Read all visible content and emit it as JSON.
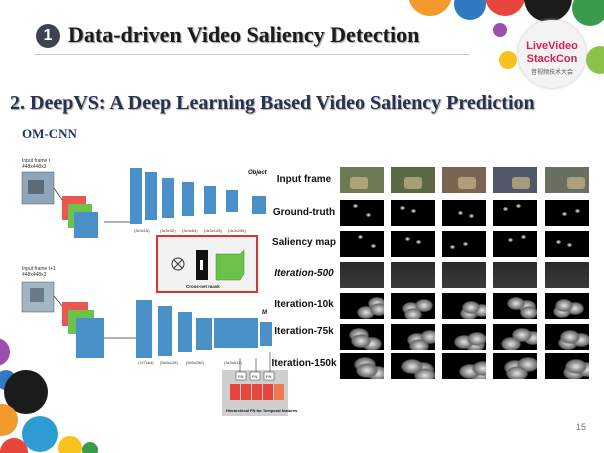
{
  "header": {
    "number": "1",
    "title": "Data-driven Video Saliency Detection"
  },
  "section": {
    "title": "2. DeepVS: A Deep Learning Based Video Saliency Prediction",
    "model_label": "OM-CNN"
  },
  "logo": {
    "line1": "LiveVideo",
    "line2": "StackCon",
    "line3": "音视频技术大会"
  },
  "diagram": {
    "input_t_label": "Input frame t",
    "input_t_size": "448x448x3",
    "input_t1_label": "Input frame t+1",
    "input_t1_size": "448x448x3",
    "object_label": "Object",
    "motion_label": "M",
    "crossnet_label": "Cross-net mask",
    "fn_label": "Hierarchical FN for Temporal features",
    "conv_top": [
      "(3x3x16)",
      "(3x3x32)",
      "(3x3x64)",
      "(3x3x128)",
      "(3x3x256)"
    ],
    "conv_bottom": [
      "(7x7x64)",
      "(5x5x128)",
      "(5x5x256)",
      "(3x3x512)"
    ],
    "fn_nodes": [
      "FN",
      "FN",
      "FN"
    ]
  },
  "grid": {
    "row_labels": [
      "Input frame",
      "Ground-truth",
      "Saliency map",
      "Iteration-500",
      "Iteration-10k",
      "Iteration-75k",
      "Iteration-150k"
    ],
    "italic_rows": [
      3
    ]
  },
  "page_number": "15",
  "colors": {
    "conv_blue": "#4a90c8",
    "fn_red": "#e8453c",
    "mask_green": "#6cc24a",
    "highlight_red": "#e03030"
  }
}
